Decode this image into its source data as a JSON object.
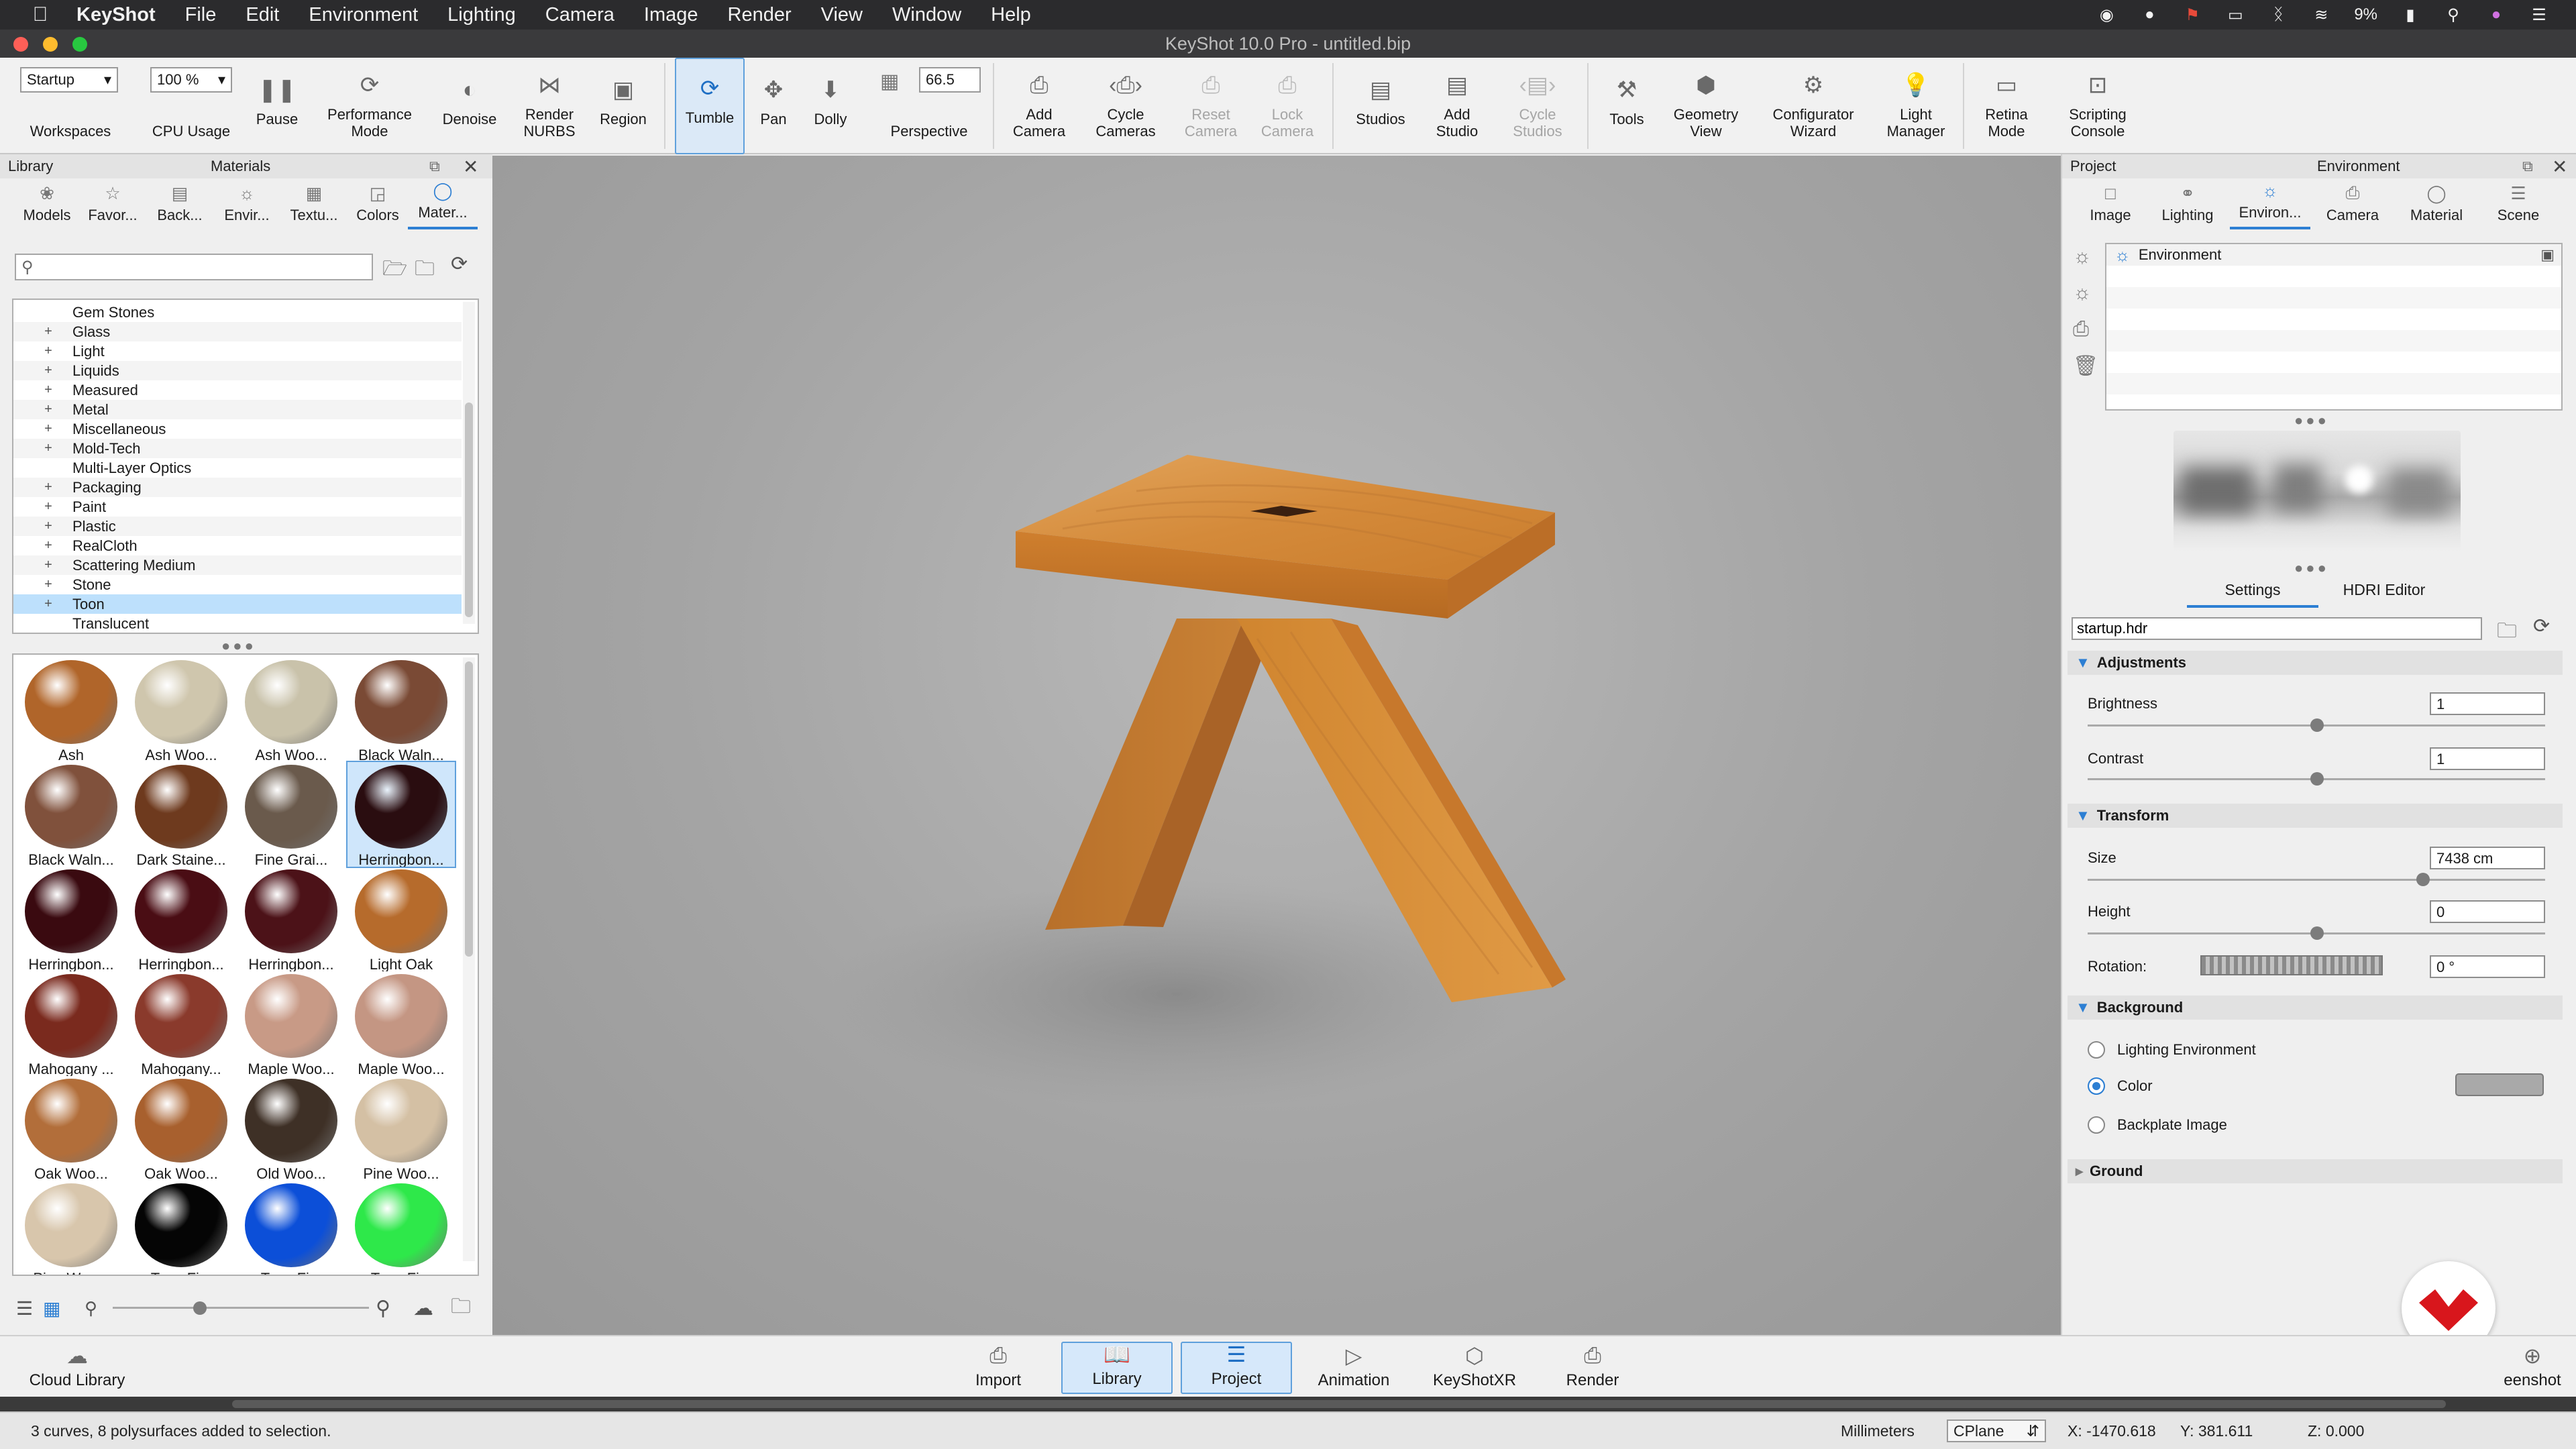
{
  "menubar": {
    "app": "KeyShot",
    "items": [
      "File",
      "Edit",
      "Environment",
      "Lighting",
      "Camera",
      "Image",
      "Render",
      "View",
      "Window",
      "Help"
    ],
    "battery": "9%"
  },
  "window": {
    "title": "KeyShot 10.0 Pro  - untitled.bip"
  },
  "ribbon": {
    "workspaces_value": "Startup",
    "workspaces_label": "Workspaces",
    "cpu_value": "100 %",
    "cpu_label": "CPU Usage",
    "pause": "Pause",
    "performance": "Performance Mode",
    "denoise": "Denoise",
    "render_nurbs": "Render NURBS",
    "region": "Region",
    "tumble": "Tumble",
    "pan": "Pan",
    "dolly": "Dolly",
    "fov_value": "66.5",
    "perspective": "Perspective",
    "add_camera": "Add Camera",
    "cycle_cameras": "Cycle Cameras",
    "reset_camera": "Reset Camera",
    "lock_camera": "Lock Camera",
    "studios": "Studios",
    "add_studio": "Add Studio",
    "cycle_studios": "Cycle Studios",
    "tools": "Tools",
    "geometry_view": "Geometry View",
    "configurator_wizard": "Configurator Wizard",
    "light_manager": "Light Manager",
    "retina_mode": "Retina Mode",
    "scripting_console": "Scripting Console"
  },
  "library": {
    "header_left": "Library",
    "header_center": "Materials",
    "tabs": [
      "Models",
      "Favor...",
      "Back...",
      "Envir...",
      "Textu...",
      "Colors",
      "Mater..."
    ],
    "tree": [
      {
        "label": "Gem Stones",
        "plus": ""
      },
      {
        "label": "Glass",
        "plus": "+"
      },
      {
        "label": "Light",
        "plus": "+"
      },
      {
        "label": "Liquids",
        "plus": "+"
      },
      {
        "label": "Measured",
        "plus": "+"
      },
      {
        "label": "Metal",
        "plus": "+"
      },
      {
        "label": "Miscellaneous",
        "plus": "+"
      },
      {
        "label": "Mold-Tech",
        "plus": "+"
      },
      {
        "label": "Multi-Layer Optics",
        "plus": ""
      },
      {
        "label": "Packaging",
        "plus": "+"
      },
      {
        "label": "Paint",
        "plus": "+"
      },
      {
        "label": "Plastic",
        "plus": "+"
      },
      {
        "label": "RealCloth",
        "plus": "+"
      },
      {
        "label": "Scattering Medium",
        "plus": "+"
      },
      {
        "label": "Stone",
        "plus": "+"
      },
      {
        "label": "Toon",
        "plus": "+"
      },
      {
        "label": "Translucent",
        "plus": ""
      }
    ],
    "materials": [
      {
        "label": "Ash",
        "color": "#b0652a"
      },
      {
        "label": "Ash Woo...",
        "color": "#cfc6ad"
      },
      {
        "label": "Ash Woo...",
        "color": "#c9c2aa"
      },
      {
        "label": "Black Waln...",
        "color": "#7a4a35"
      },
      {
        "label": "Black Waln...",
        "color": "#80513c"
      },
      {
        "label": "Dark Staine...",
        "color": "#6e3a1e"
      },
      {
        "label": "Fine Grai...",
        "color": "#6a5a4c"
      },
      {
        "label": "Herringbon...",
        "color": "#2a0d10"
      },
      {
        "label": "Herringbon...",
        "color": "#3a0a10"
      },
      {
        "label": "Herringbon...",
        "color": "#4a0d14"
      },
      {
        "label": "Herringbon...",
        "color": "#4c1218"
      },
      {
        "label": "Light Oak",
        "color": "#b66b2c"
      },
      {
        "label": "Mahogany ...",
        "color": "#7a2a1e"
      },
      {
        "label": "Mahogany...",
        "color": "#8a3a2c"
      },
      {
        "label": "Maple Woo...",
        "color": "#c89a86"
      },
      {
        "label": "Maple Woo...",
        "color": "#c49683"
      },
      {
        "label": "Oak Woo...",
        "color": "#b26e3a"
      },
      {
        "label": "Oak Woo...",
        "color": "#a8602e"
      },
      {
        "label": "Old Woo...",
        "color": "#3e3026"
      },
      {
        "label": "Pine Woo...",
        "color": "#d4c0a4"
      },
      {
        "label": "Pine Woo...",
        "color": "#d8c6ac"
      },
      {
        "label": "Toon Fi...",
        "color": "#050505"
      },
      {
        "label": "Toon Fi...",
        "color": "#0c4fd8"
      },
      {
        "label": "Toon Fi...",
        "color": "#2ee84a"
      }
    ],
    "selected_material_index": 7
  },
  "project": {
    "header_left": "Project",
    "header_center": "Environment",
    "tabs": [
      "Image",
      "Lighting",
      "Environ...",
      "Camera",
      "Material",
      "Scene"
    ],
    "env_list_item": "Environment",
    "subtabs": [
      "Settings",
      "HDRI Editor"
    ],
    "hdr_file": "startup.hdr",
    "adjustments": "Adjustments",
    "brightness_label": "Brightness",
    "brightness_value": "1",
    "contrast_label": "Contrast",
    "contrast_value": "1",
    "transform": "Transform",
    "size_label": "Size",
    "size_value": "7438 cm",
    "height_label": "Height",
    "height_value": "0",
    "rotation_label": "Rotation:",
    "rotation_value": "0 °",
    "background": "Background",
    "bg_opt1": "Lighting Environment",
    "bg_opt2": "Color",
    "bg_opt3": "Backplate Image",
    "bg_color": "#a9a9a9",
    "ground": "Ground"
  },
  "bottombar": {
    "cloud_library": "Cloud Library",
    "import": "Import",
    "library": "Library",
    "project": "Project",
    "animation": "Animation",
    "keyshotxr": "KeyShotXR",
    "render": "Render",
    "screenshot": "eenshot"
  },
  "statusbar": {
    "message": "3 curves, 8 polysurfaces added to selection.",
    "units": "Millimeters",
    "cplane": "CPlane",
    "x": "X: -1470.618",
    "y": "Y: 381.611",
    "z": "Z: 0.000"
  },
  "colors": {
    "accent": "#2d7fd3",
    "wood": "#d68a3c",
    "brand": "#d8161c"
  }
}
